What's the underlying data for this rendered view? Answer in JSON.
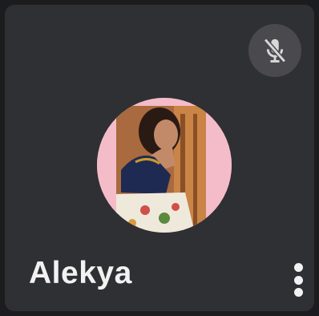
{
  "participant": {
    "name": "Alekya",
    "mic_status": "muted",
    "mic_icon": "mic-off-icon",
    "menu_icon": "more-vert-icon"
  },
  "colors": {
    "tile_background": "#2f3033",
    "page_background": "#1c1c1f",
    "badge_background": "#4a4a4e",
    "avatar_ring": "#f4bcc9",
    "text": "#f2f2f2"
  }
}
